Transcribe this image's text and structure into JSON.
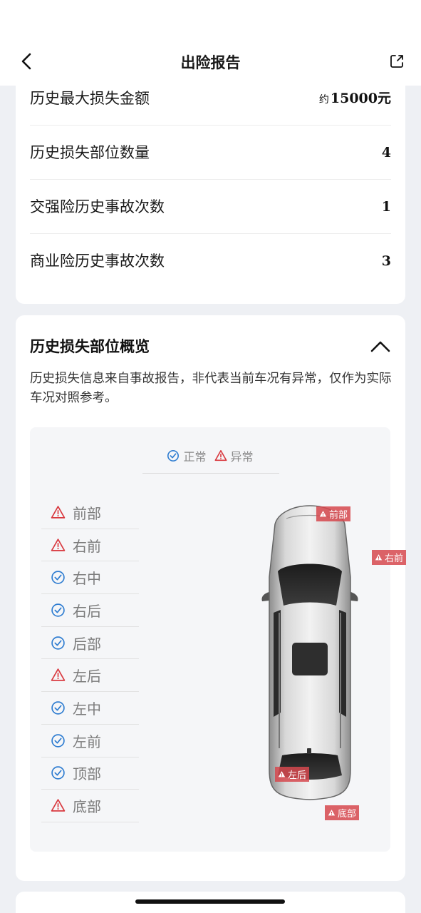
{
  "header": {
    "title": "出险报告",
    "back_icon": "chevron-left-icon",
    "share_icon": "share-icon"
  },
  "stats": [
    {
      "label": "历史最大损失金额",
      "prefix": "约",
      "value": "15000元"
    },
    {
      "label": "历史损失部位数量",
      "prefix": "",
      "value": "4"
    },
    {
      "label": "交强险历史事故次数",
      "prefix": "",
      "value": "1"
    },
    {
      "label": "商业险历史事故次数",
      "prefix": "",
      "value": "3"
    }
  ],
  "overview": {
    "title": "历史损失部位概览",
    "collapse_icon": "chevron-up-icon",
    "description": "历史损失信息来自事故报告，非代表当前车况有异常，仅作为实际车况对照参考。",
    "legend": {
      "normal": "正常",
      "abnormal": "异常"
    },
    "parts": [
      {
        "name": "前部",
        "status": "abnormal"
      },
      {
        "name": "右前",
        "status": "abnormal"
      },
      {
        "name": "右中",
        "status": "normal"
      },
      {
        "name": "右后",
        "status": "normal"
      },
      {
        "name": "后部",
        "status": "normal"
      },
      {
        "name": "左后",
        "status": "abnormal"
      },
      {
        "name": "左中",
        "status": "normal"
      },
      {
        "name": "左前",
        "status": "normal"
      },
      {
        "name": "顶部",
        "status": "normal"
      },
      {
        "name": "底部",
        "status": "abnormal"
      }
    ],
    "car_tags": [
      "前部",
      "右前",
      "左后",
      "底部"
    ]
  },
  "colors": {
    "normal": "#2f7dd1",
    "abnormal": "#d93a40",
    "tag_bg": "#d6484e"
  }
}
